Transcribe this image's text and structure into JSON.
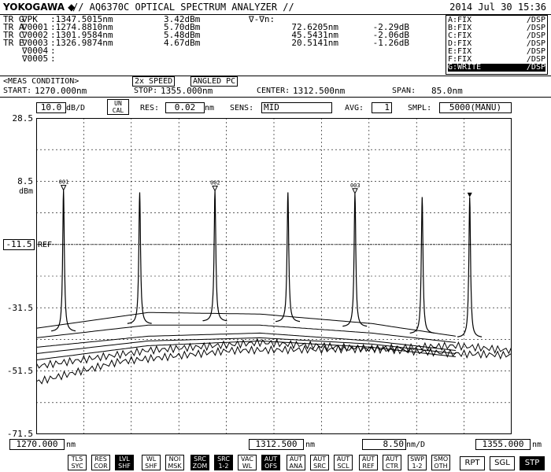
{
  "header": {
    "brand": "YOKOGAWA ◆",
    "model": "// AQ6370C OPTICAL SPECTRUM ANALYZER //",
    "datetime": "2014 Jul 30 15:36"
  },
  "markers": {
    "vdelta_label": "∇-∇n:",
    "rows": [
      {
        "tr": "TR G",
        "name": "∇PK",
        "wl": ":1347.5015nm",
        "lvl": "3.42dBm",
        "dwl": "",
        "dlvl": ""
      },
      {
        "tr": "TR A",
        "name": "∇0001",
        "wl": ":1274.8810nm",
        "lvl": "5.70dBm",
        "dwl": "72.6205nm",
        "dlvl": "-2.29dB"
      },
      {
        "tr": "TR C",
        "name": "∇0002",
        "wl": ":1301.9584nm",
        "lvl": "5.48dBm",
        "dwl": "45.5431nm",
        "dlvl": "-2.06dB"
      },
      {
        "tr": "TR E",
        "name": "∇0003",
        "wl": ":1326.9874nm",
        "lvl": "4.67dBm",
        "dwl": "20.5141nm",
        "dlvl": "-1.26dB"
      },
      {
        "tr": "",
        "name": "∇0004",
        "wl": ":",
        "lvl": "",
        "dwl": "",
        "dlvl": ""
      },
      {
        "tr": "",
        "name": "∇0005",
        "wl": ":",
        "lvl": "",
        "dwl": "",
        "dlvl": ""
      }
    ]
  },
  "traces": [
    {
      "name": "A:FIX",
      "mode": "/DSP",
      "selected": false
    },
    {
      "name": "B:FIX",
      "mode": "/DSP",
      "selected": false
    },
    {
      "name": "C:FIX",
      "mode": "/DSP",
      "selected": false
    },
    {
      "name": "D:FIX",
      "mode": "/DSP",
      "selected": false
    },
    {
      "name": "E:FIX",
      "mode": "/DSP",
      "selected": false
    },
    {
      "name": "F:FIX",
      "mode": "/DSP",
      "selected": false
    },
    {
      "name": "G:WRITE",
      "mode": "/DSP",
      "selected": true
    }
  ],
  "meas": {
    "title": "<MEAS CONDITION>",
    "tag1": "2x SPEED",
    "tag2": "ANGLED PC",
    "start_label": "START:",
    "start": "1270.000nm",
    "stop_label": "STOP:",
    "stop": "1355.000nm",
    "center_label": "CENTER:",
    "center": "1312.500nm",
    "span_label": "SPAN:",
    "span": "85.0nm"
  },
  "settings": {
    "scale": "10.0",
    "scale_unit": "dB/D",
    "uncal": "UN CAL",
    "res_label": "RES:",
    "res": "0.02",
    "res_unit": "nm",
    "sens_label": "SENS:",
    "sens": "MID",
    "avg_label": "AVG:",
    "avg": "1",
    "smpl_label": "SMPL:",
    "smpl": "5000(MANU)"
  },
  "yaxis": {
    "ticks": [
      "28.5",
      "8.5",
      "-31.5",
      "-51.5",
      "-71.5"
    ],
    "unit": "dBm",
    "ref": "-11.5",
    "ref_label": "REF"
  },
  "xaxis": {
    "start": "1270.000",
    "center": "1312.500",
    "div": "8.50",
    "stop": "1355.000",
    "unit": "nm",
    "div_unit": "nm/D"
  },
  "marker_labels": [
    "001",
    "002",
    "003"
  ],
  "softkeys": [
    {
      "label": "TLS SYC",
      "on": false
    },
    {
      "label": "RES COR",
      "on": false
    },
    {
      "label": "LVL SHF",
      "on": true
    },
    {
      "label": "WL SHF",
      "on": false
    },
    {
      "label": "NOI MSK",
      "on": false
    },
    {
      "label": "SRC ZOM",
      "on": true
    },
    {
      "label": "SRC 1-2",
      "on": true
    },
    {
      "label": "VAC WL",
      "on": false
    },
    {
      "label": "AUT OFS",
      "on": true
    },
    {
      "label": "AUT ANA",
      "on": false
    },
    {
      "label": "AUT SRC",
      "on": false
    },
    {
      "label": "AUT SCL",
      "on": false
    },
    {
      "label": "AUT REF",
      "on": false
    },
    {
      "label": "AUT CTR",
      "on": false
    },
    {
      "label": "SWP 1-2",
      "on": false
    },
    {
      "label": "SMO OTH",
      "on": false
    }
  ],
  "actionkeys": [
    {
      "label": "RPT",
      "on": false
    },
    {
      "label": "SGL",
      "on": false
    },
    {
      "label": "STP",
      "on": true
    }
  ],
  "chart_data": {
    "type": "line",
    "xlabel": "nm",
    "ylabel": "dBm",
    "xlim": [
      1270.0,
      1355.0
    ],
    "ylim": [
      -71.5,
      28.5
    ],
    "peaks": [
      {
        "x": 1274.881,
        "y": 5.7
      },
      {
        "x": 1288.5,
        "y": 5.0
      },
      {
        "x": 1301.958,
        "y": 5.48
      },
      {
        "x": 1315.0,
        "y": 5.0
      },
      {
        "x": 1326.987,
        "y": 4.67
      },
      {
        "x": 1339.0,
        "y": 3.5
      },
      {
        "x": 1347.502,
        "y": 3.42
      }
    ],
    "baselines": [
      {
        "name": "",
        "values": [
          [
            1270,
            -38.0
          ],
          [
            1290,
            -33.0
          ],
          [
            1310,
            -33.5
          ],
          [
            1330,
            -36.5
          ],
          [
            1345,
            -40.5
          ]
        ]
      },
      {
        "name": "",
        "values": [
          [
            1270,
            -41.0
          ],
          [
            1290,
            -37.0
          ],
          [
            1310,
            -37.0
          ],
          [
            1330,
            -39.5
          ],
          [
            1345,
            -42.5
          ]
        ]
      },
      {
        "name": "",
        "values": [
          [
            1270,
            -44.0
          ],
          [
            1290,
            -40.5
          ],
          [
            1310,
            -39.5
          ],
          [
            1330,
            -42.0
          ],
          [
            1345,
            -45.0
          ]
        ]
      },
      {
        "name": "",
        "values": [
          [
            1270,
            -46.0
          ],
          [
            1290,
            -42.0
          ],
          [
            1310,
            -41.0
          ],
          [
            1330,
            -43.0
          ],
          [
            1345,
            -46.0
          ]
        ]
      },
      {
        "name": "",
        "values": [
          [
            1270,
            -48.0
          ],
          [
            1290,
            -43.5
          ],
          [
            1310,
            -42.0
          ],
          [
            1330,
            -44.0
          ],
          [
            1345,
            -47.0
          ]
        ]
      },
      {
        "name": "",
        "values": [
          [
            1270,
            -50.0
          ],
          [
            1290,
            -45.0
          ],
          [
            1310,
            -42.5
          ],
          [
            1330,
            -44.5
          ],
          [
            1345,
            -46.0
          ],
          [
            1355,
            -46.5
          ]
        ]
      },
      {
        "name": "",
        "values": [
          [
            1270,
            -55.0
          ],
          [
            1285,
            -48.5
          ],
          [
            1305,
            -45.0
          ],
          [
            1330,
            -44.5
          ],
          [
            1345,
            -43.5
          ],
          [
            1355,
            -45.0
          ]
        ]
      }
    ]
  }
}
